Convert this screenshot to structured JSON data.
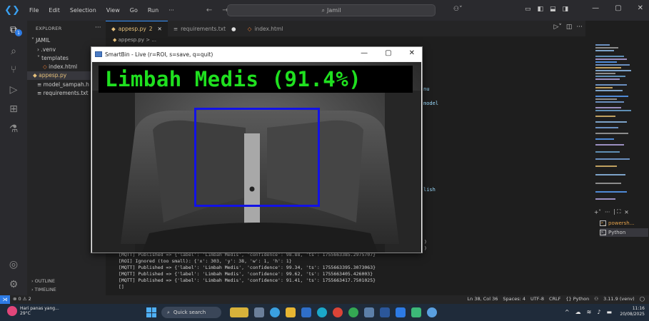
{
  "titlebar": {
    "menu": [
      "File",
      "Edit",
      "Selection",
      "View",
      "Go",
      "Run",
      "···"
    ],
    "search_text": "Jamil"
  },
  "explorer": {
    "header": "EXPLORER",
    "root_folder": "JAMIL",
    "items": [
      ".venv",
      "templates",
      "index.html",
      "appesp.py",
      "model_sampah.h",
      "requirements.txt"
    ],
    "outline": "OUTLINE",
    "timeline": "TIMELINE"
  },
  "tabs": [
    {
      "label": "appesp.py",
      "badge": "2"
    },
    {
      "label": "requirements.txt"
    },
    {
      "label": "index.html"
    }
  ],
  "breadcrumb": "appesp.py > ...",
  "code_fragments": [
    "nu",
    "model",
    "lish"
  ],
  "smartbin": {
    "title": "SmartBin - Live (r=ROI, s=save, q=quit)",
    "label": "Limbah Medis (91.4%)"
  },
  "terminal": {
    "lines": [
      ")",
      ")",
      "[MQTT] Published => {'label': 'Limbah Medis', 'confidence': 98.88, 'ts': 1755663385.2975707}",
      "[ROI] Ignored (too small): {'x': 303, 'y': 38, 'w': 1, 'h': 1}",
      "[MQTT] Published => {'label': 'Limbah Medis', 'confidence': 99.34, 'ts': 1755663395.3073063}",
      "[MQTT] Published => {'label': 'Limbah Medis', 'confidence': 99.62, 'ts': 1755663405.426003}",
      "[MQTT] Published => {'label': 'Limbah Medis', 'confidence': 91.41, 'ts': 1755663417.7501025}",
      "[]"
    ],
    "sessions": [
      "powersh...",
      "Python"
    ]
  },
  "statusbar": {
    "problems": "⊗ 0 ⚠ 2",
    "position": "Ln 38, Col 36",
    "spaces": "Spaces: 4",
    "encoding": "UTF-8",
    "eol": "CRLF",
    "language": "{} Python",
    "interpreter": "3.11.9 (venv)"
  },
  "taskbar": {
    "weather_line1": "Hari panas yang...",
    "weather_line2": "29°C",
    "search": "Quick search",
    "time": "11:16",
    "date": "20/08/2025"
  },
  "colors": {
    "accent": "#3794ff",
    "detection_label": "#1fe01f",
    "roi_box": "#1212e6"
  }
}
